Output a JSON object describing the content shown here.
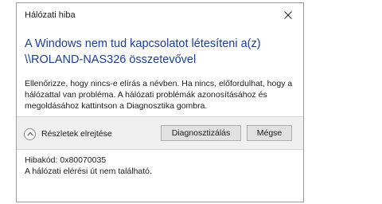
{
  "window": {
    "title": "Hálózati hiba"
  },
  "main": {
    "heading_line1": "A Windows nem tud kapcsolatot létesíteni a(z)",
    "heading_line2": "\\\\ROLAND-NAS326 összetevővel",
    "body_text": "Ellenőrizze, hogy nincs-e elírás a névben. Ha nincs, előfordulhat, hogy a hálózattal van probléma. A hálózati problémák azonosításához és megoldásához kattintson a Diagnosztika gombra."
  },
  "actions": {
    "details_toggle_label": "Részletek elrejtése",
    "diagnose_label": "Diagnosztizálás",
    "cancel_label": "Mégse"
  },
  "details": {
    "error_code": "Hibakód: 0x80070035",
    "error_message": "A hálózati elérési út nem található."
  },
  "icons": {
    "close": "close-icon",
    "details_toggle": "chevron-up-icon"
  },
  "colors": {
    "heading": "#1b3d9b",
    "action_bar": "#f0f0f0",
    "button": "#e1e1e1"
  }
}
